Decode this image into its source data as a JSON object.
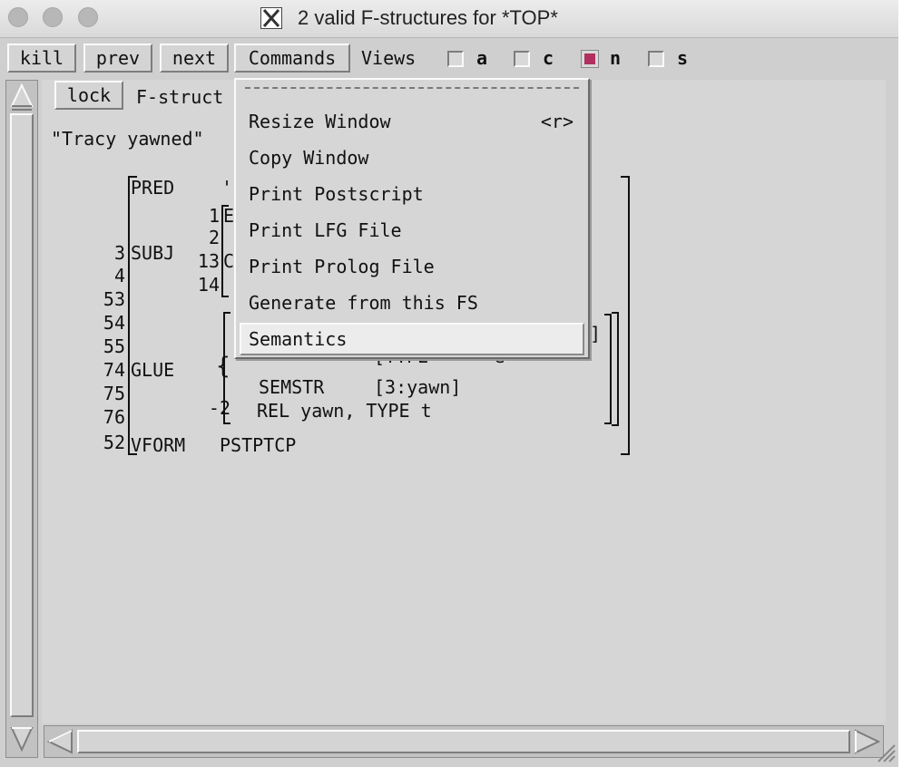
{
  "window": {
    "title": "2 valid F-structures for *TOP*"
  },
  "toolbar": {
    "buttons": [
      "kill",
      "prev",
      "next",
      "Commands"
    ],
    "views_label": "Views",
    "view_options": [
      {
        "label": "a",
        "checked": false
      },
      {
        "label": "c",
        "checked": false
      },
      {
        "label": "n",
        "checked": true
      },
      {
        "label": "s",
        "checked": false
      }
    ]
  },
  "pane": {
    "lock_label": "lock",
    "header_text": "F-struct",
    "sentence": "\"Tracy yawned\""
  },
  "fstructure": {
    "attrs": {
      "pred": "PRED",
      "pred_value_partial": "'",
      "subj": "SUBJ",
      "glue": "GLUE",
      "semstr": "SEMSTR",
      "semstr_value": "[3:yawn]",
      "rel_line": "REL yawn, TYPE t",
      "vform": "VFORM",
      "vform_value": "PSTPTCP",
      "partial_bracket_tail": "]",
      "partial_fragment": "[TYPE      e",
      "partial_e": "E",
      "partial_c": "C"
    },
    "indices": {
      "i1": "1",
      "i2": "2",
      "i3": "3",
      "i4": "4",
      "i13": "13",
      "i14": "14",
      "i53": "53",
      "i54": "54",
      "i55": "55",
      "i74": "74",
      "i75": "75",
      "i76": "76",
      "i52": "52",
      "neg2": "-2"
    }
  },
  "menu": {
    "items": [
      {
        "label": "Resize Window",
        "accel": "<r>"
      },
      {
        "label": "Copy Window",
        "accel": ""
      },
      {
        "label": "Print Postscript",
        "accel": ""
      },
      {
        "label": "Print LFG File",
        "accel": ""
      },
      {
        "label": "Print Prolog File",
        "accel": ""
      },
      {
        "label": "Generate from this FS",
        "accel": ""
      },
      {
        "label": "Semantics",
        "accel": ""
      }
    ],
    "active_index": 6
  },
  "colors": {
    "checked_box": "#b03060",
    "window_bg": "#cfcfcf"
  }
}
